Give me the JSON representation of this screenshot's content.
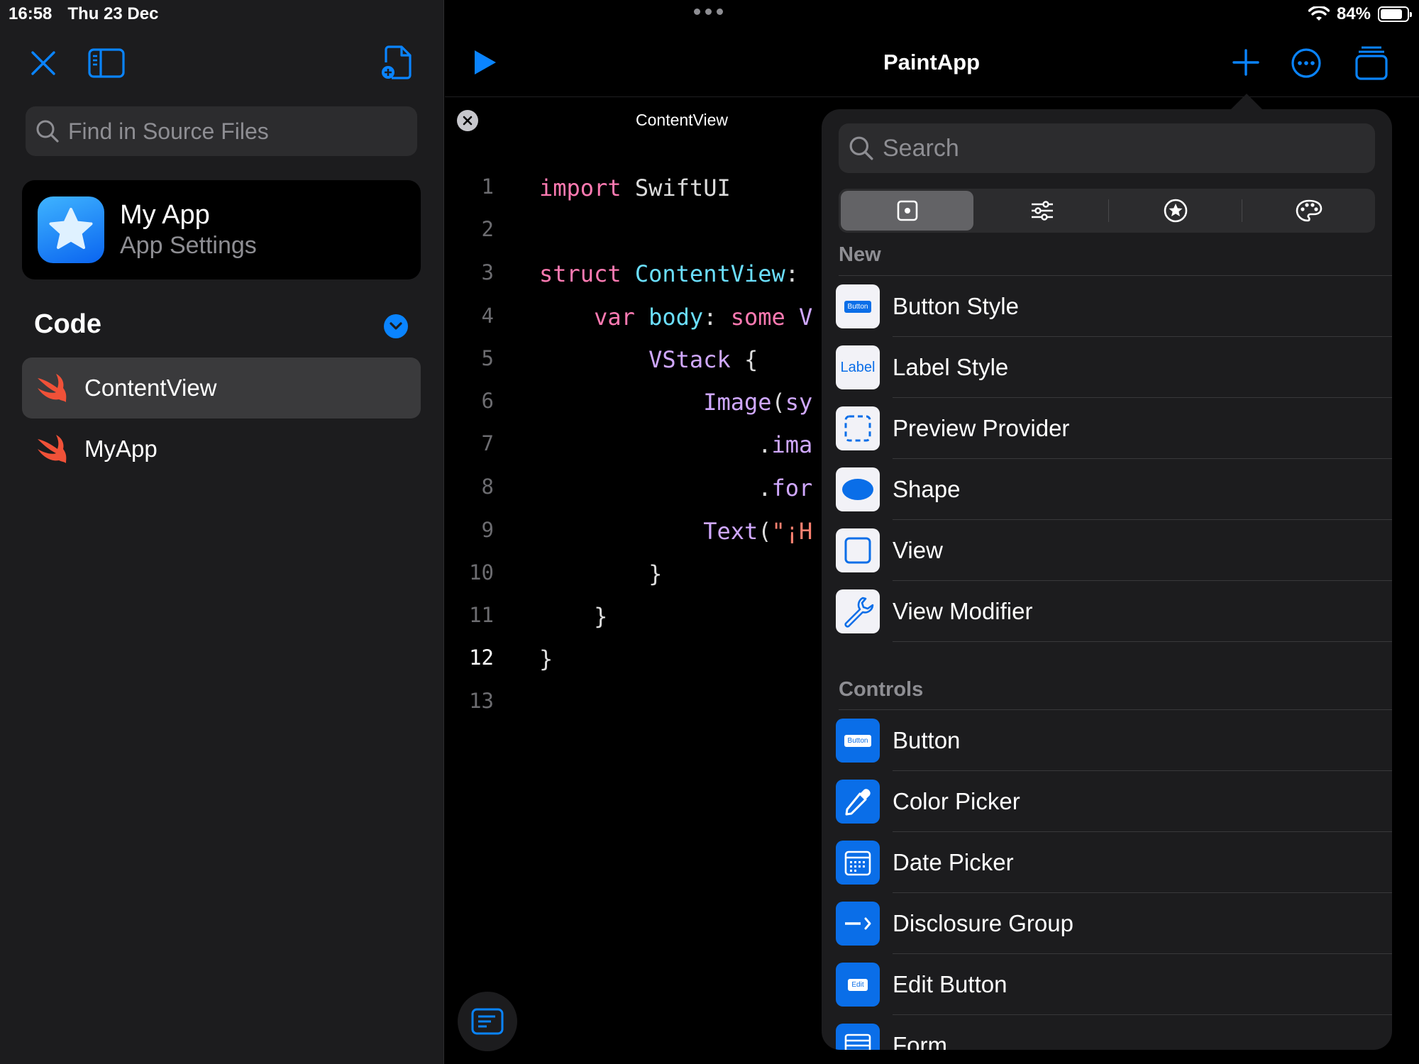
{
  "status": {
    "time": "16:58",
    "date": "Thu 23 Dec",
    "battery": "84%",
    "battery_level": 0.84
  },
  "sidebar": {
    "search_placeholder": "Find in Source Files",
    "app": {
      "name": "My App",
      "subtitle": "App Settings"
    },
    "section_title": "Code",
    "files": [
      {
        "label": "ContentView",
        "active": true
      },
      {
        "label": "MyApp",
        "active": false
      }
    ]
  },
  "editor": {
    "project_title": "PaintApp",
    "tab_title": "ContentView",
    "current_line": 12,
    "lines": [
      {
        "n": "1",
        "t": "import SwiftUI"
      },
      {
        "n": "2",
        "t": ""
      },
      {
        "n": "3",
        "t": "struct ContentView:"
      },
      {
        "n": "4",
        "t": "    var body: some V"
      },
      {
        "n": "5",
        "t": "        VStack {"
      },
      {
        "n": "6",
        "t": "            Image(sy"
      },
      {
        "n": "7",
        "t": "                .ima"
      },
      {
        "n": "8",
        "t": "                .for"
      },
      {
        "n": "9",
        "t": "            Text(\"¡H"
      },
      {
        "n": "10",
        "t": "        }"
      },
      {
        "n": "11",
        "t": "    }"
      },
      {
        "n": "12",
        "t": "}"
      },
      {
        "n": "13",
        "t": ""
      }
    ]
  },
  "library": {
    "search_placeholder": "Search",
    "tabs": [
      "views-icon",
      "modifiers-icon",
      "favorites-icon",
      "colors-icon"
    ],
    "sections": [
      {
        "title": "New",
        "items": [
          {
            "label": "Button Style",
            "icon": "button-style-icon"
          },
          {
            "label": "Label Style",
            "icon": "label-style-icon",
            "icon_text": "Label"
          },
          {
            "label": "Preview Provider",
            "icon": "preview-provider-icon"
          },
          {
            "label": "Shape",
            "icon": "shape-icon"
          },
          {
            "label": "View",
            "icon": "view-icon"
          },
          {
            "label": "View Modifier",
            "icon": "wrench-icon"
          }
        ]
      },
      {
        "title": "Controls",
        "items": [
          {
            "label": "Button",
            "icon": "button-icon"
          },
          {
            "label": "Color Picker",
            "icon": "eyedropper-icon"
          },
          {
            "label": "Date Picker",
            "icon": "calendar-icon"
          },
          {
            "label": "Disclosure Group",
            "icon": "disclosure-icon"
          },
          {
            "label": "Edit Button",
            "icon": "edit-button-icon",
            "icon_text": "Edit"
          },
          {
            "label": "Form",
            "icon": "form-icon"
          }
        ]
      }
    ],
    "icon_button_text": "Button"
  },
  "colors": {
    "accent": "#0a84ff",
    "swift_orange": "#f05138"
  }
}
